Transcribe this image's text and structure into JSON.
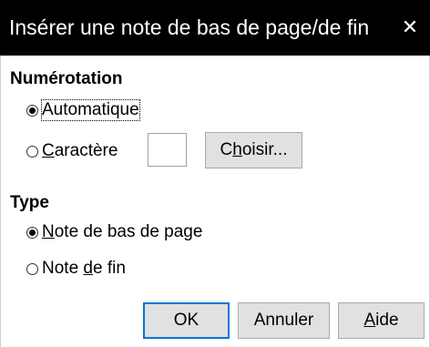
{
  "dialog": {
    "title": "Insérer une note de bas de page/de fin",
    "close_glyph": "✕"
  },
  "numbering": {
    "heading": "Numérotation",
    "automatic_label": "Automatique",
    "automatic_checked": true,
    "character_label_prefix": "",
    "character_label_ul": "C",
    "character_label_rest": "aractère",
    "character_value": "",
    "choose_prefix": "C",
    "choose_ul": "h",
    "choose_rest": "oisir..."
  },
  "type": {
    "heading": "Type",
    "footnote_ul": "N",
    "footnote_rest": "ote de bas de page",
    "footnote_checked": true,
    "endnote_prefix": "Note ",
    "endnote_ul": "d",
    "endnote_rest": "e fin",
    "endnote_checked": false
  },
  "buttons": {
    "ok": "OK",
    "cancel": "Annuler",
    "help_ul": "A",
    "help_rest": "ide"
  },
  "colors": {
    "titlebar_bg": "#000000",
    "titlebar_fg": "#ffffff",
    "button_bg": "#e1e1e1",
    "default_button_border": "#0078d7"
  }
}
